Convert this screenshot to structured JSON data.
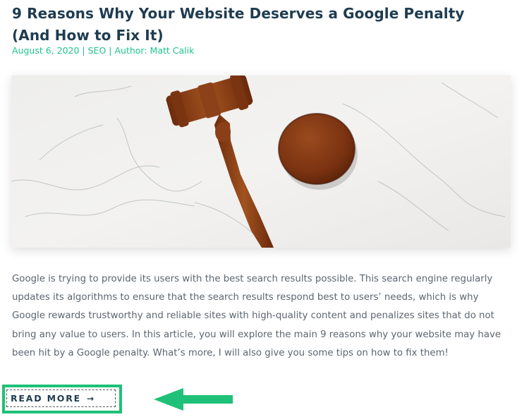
{
  "post": {
    "title": "9 Reasons Why Your Website Deserves a Google Penalty (And How to Fix It)",
    "date": "August 6, 2020",
    "separator": "|",
    "category": "SEO",
    "author": "Author: Matt Calik",
    "excerpt": "Google is trying to provide its users with the best search results possible. This search engine regularly updates its algorithms to ensure that the search results respond best to users’ needs, which is why Google rewards trustworthy and reliable sites with high-quality content and penalizes sites that do not bring any value to users. In this article, you will explore the main 9 reasons why your website may have been hit by a Google penalty. What’s more, I will also give you some tips on how to fix them!",
    "read_more_label": "READ MORE",
    "read_more_arrow": "→"
  },
  "image": {
    "description": "wooden-gavel-on-marble"
  },
  "colors": {
    "title": "#1f3c50",
    "accent": "#1ec58a",
    "highlight": "#1ec177",
    "body_text": "#5c6670"
  }
}
